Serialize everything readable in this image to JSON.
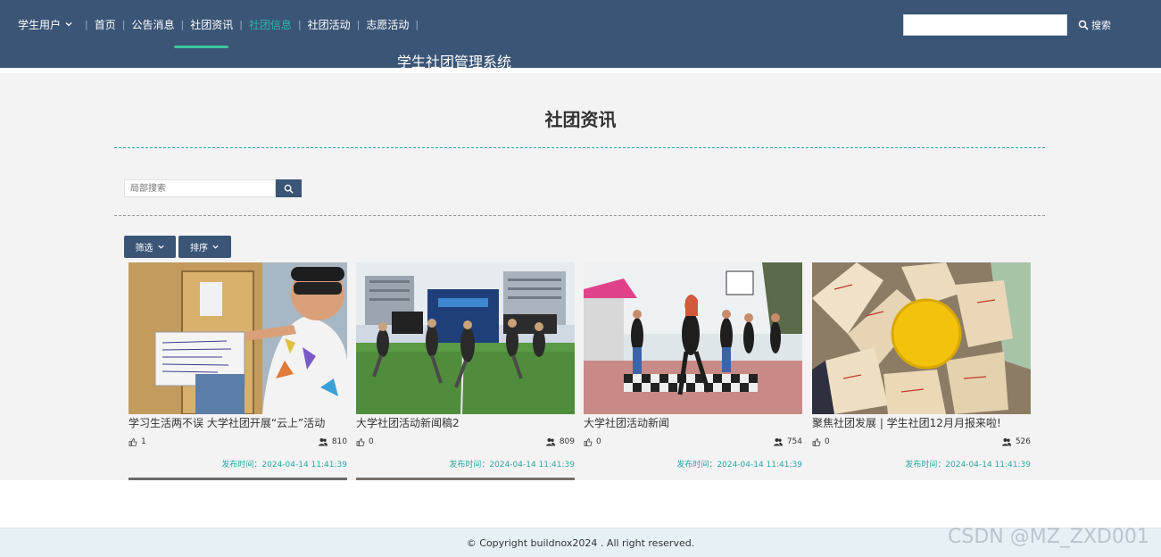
{
  "header": {
    "user_menu_label": "学生用户",
    "nav": [
      {
        "label": "首页"
      },
      {
        "label": "公告消息"
      },
      {
        "label": "社团资讯"
      },
      {
        "label": "社团信息"
      },
      {
        "label": "社团活动"
      },
      {
        "label": "志愿活动"
      }
    ],
    "brand": "学生社团管理系统",
    "search_placeholder": "",
    "search_button": "搜索"
  },
  "main": {
    "page_title": "社团资讯",
    "local_search_placeholder": "局部搜索",
    "filter_label": "筛选",
    "sort_label": "排序"
  },
  "cards": [
    {
      "title": "学习生活两不误 大学社团开展“云上”活动",
      "likes": "1",
      "views": "810",
      "date_label": "发布时间：",
      "date": "2024-04-14 11:41:39"
    },
    {
      "title": "大学社团活动新闻稿2",
      "likes": "0",
      "views": "809",
      "date_label": "发布时间：",
      "date": "2024-04-14 11:41:39"
    },
    {
      "title": "大学社团活动新闻",
      "likes": "0",
      "views": "754",
      "date_label": "发布时间：",
      "date": "2024-04-14 11:41:39"
    },
    {
      "title": "聚焦社团发展 | 学生社团12月月报来啦!",
      "likes": "0",
      "views": "526",
      "date_label": "发布时间：",
      "date": "2024-04-14 11:41:39"
    }
  ],
  "footer": {
    "copyright": "© Copyright buildnox2024 . All right reserved."
  },
  "watermark": "CSDN @MZ_ZXD001",
  "colors": {
    "header_bg": "#3a5576",
    "accent_teal": "#2aa7a7",
    "nav_underline": "#3cc79a"
  }
}
